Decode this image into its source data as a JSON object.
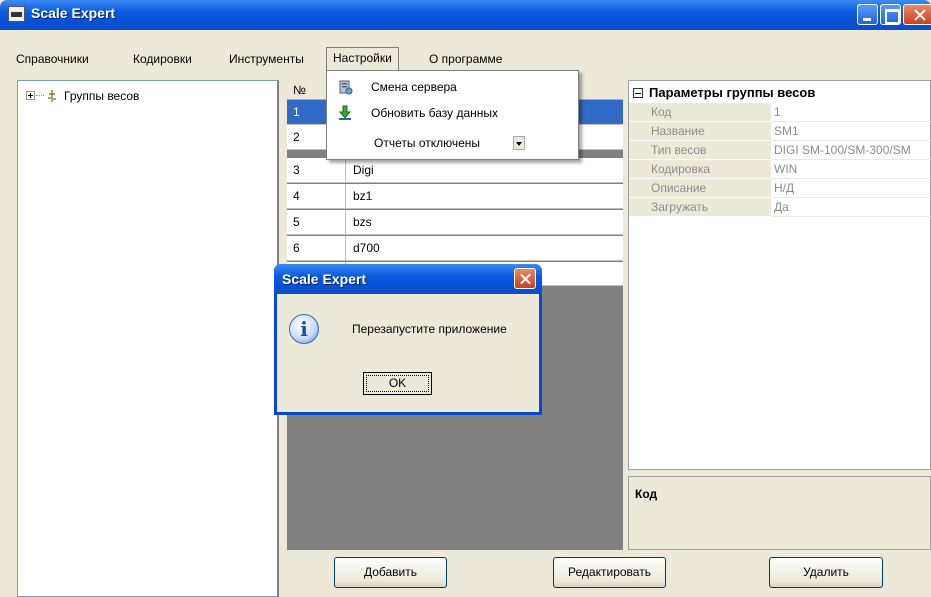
{
  "window": {
    "title": "Scale Expert"
  },
  "menu": {
    "items": [
      "Справочники",
      "Кодировки",
      "Инструменты",
      "Настройки",
      "О программе"
    ]
  },
  "settings_menu": {
    "change_server": "Смена сервера",
    "update_db": "Обновить базу данных",
    "reports": "Отчеты отключены"
  },
  "tree": {
    "root_label": "Группы весов"
  },
  "list": {
    "header_num": "№",
    "rows": [
      {
        "num": "1",
        "name": ""
      },
      {
        "num": "2",
        "name": ""
      },
      {
        "num": "3",
        "name": "Digi"
      },
      {
        "num": "4",
        "name": "bz1"
      },
      {
        "num": "5",
        "name": "bzs"
      },
      {
        "num": "6",
        "name": "d700"
      }
    ]
  },
  "properties": {
    "header": "Параметры группы весов",
    "rows": [
      {
        "key": "Код",
        "value": "1"
      },
      {
        "key": "Название",
        "value": "SM1"
      },
      {
        "key": "Тип весов",
        "value": "DIGI SM-100/SM-300/SM"
      },
      {
        "key": "Кодировка",
        "value": "WIN"
      },
      {
        "key": "Описание",
        "value": "Н/Д"
      },
      {
        "key": "Загружать",
        "value": "Да"
      }
    ],
    "description_title": "Код"
  },
  "buttons": {
    "add": "Добавить",
    "edit": "Редактировать",
    "delete": "Удалить"
  },
  "dialog": {
    "title": "Scale Expert",
    "message": "Перезапустите приложение",
    "ok": "OK"
  },
  "colors": {
    "titlebar": "#0a5ae0",
    "selection": "#316ac5",
    "list_background": "#808080"
  }
}
